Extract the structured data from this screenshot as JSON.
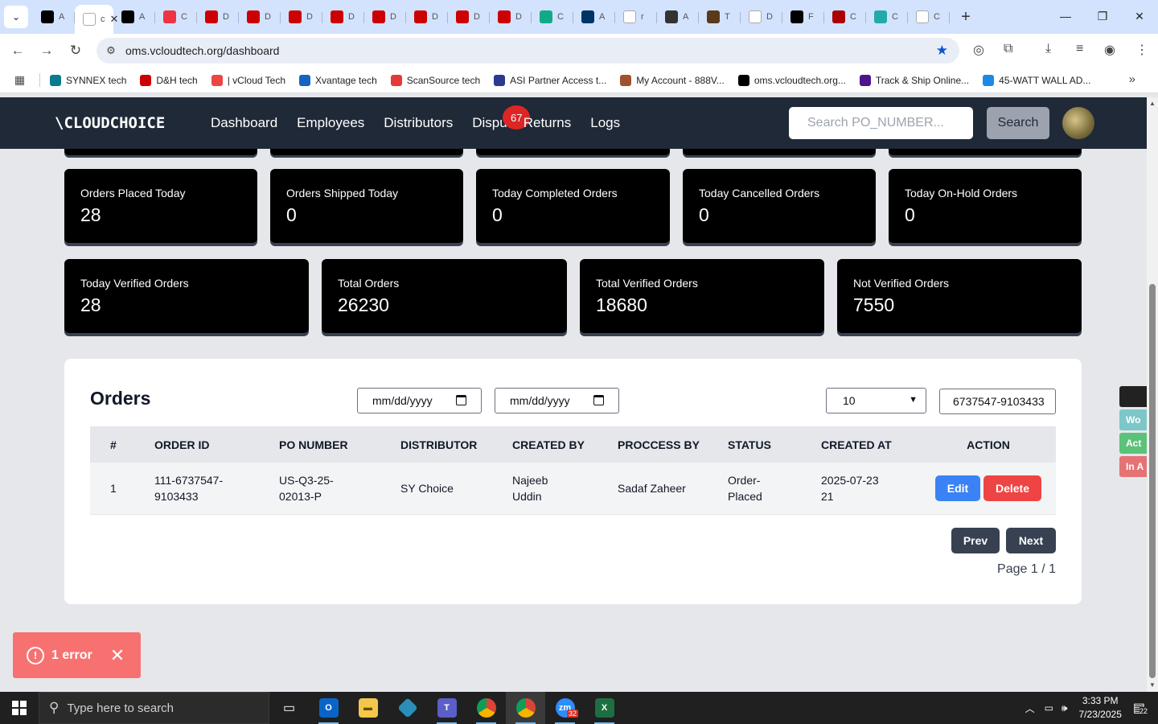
{
  "browser": {
    "tab_chars": [
      "A",
      "c",
      "A",
      "C",
      "D",
      "D",
      "D",
      "D",
      "D",
      "D",
      "D",
      "D",
      "C",
      "A",
      "r",
      "A",
      "T",
      "D",
      "F",
      "C",
      "C",
      "C"
    ],
    "url": "oms.vcloudtech.org/dashboard",
    "bookmarks": [
      {
        "label": "SYNNEX tech",
        "icon": "synnex-icon"
      },
      {
        "label": "D&H tech",
        "icon": "dh-icon"
      },
      {
        "label": "| vCloud Tech",
        "icon": "vcloud-icon"
      },
      {
        "label": "Xvantage tech",
        "icon": "xvantage-icon"
      },
      {
        "label": "ScanSource tech",
        "icon": "scansource-icon"
      },
      {
        "label": "ASI Partner Access t...",
        "icon": "asi-icon"
      },
      {
        "label": "My Account - 888V...",
        "icon": "account-icon"
      },
      {
        "label": "oms.vcloudtech.org...",
        "icon": "oms-icon"
      },
      {
        "label": "Track & Ship Online...",
        "icon": "fedex-icon"
      },
      {
        "label": "45-WATT WALL AD...",
        "icon": "adapter-icon"
      }
    ]
  },
  "app": {
    "logo": "\\CLOUDCHOICE",
    "nav": [
      "Dashboard",
      "Employees",
      "Distributors",
      "Dispu",
      "Returns",
      "Logs"
    ],
    "disputes_badge": "67",
    "search_placeholder": "Search PO_NUMBER...",
    "search_button": "Search"
  },
  "stats_row1": [
    {
      "label": "Orders Placed Today",
      "value": "28"
    },
    {
      "label": "Orders Shipped Today",
      "value": "0"
    },
    {
      "label": "Today Completed Orders",
      "value": "0"
    },
    {
      "label": "Today Cancelled Orders",
      "value": "0"
    },
    {
      "label": "Today On-Hold Orders",
      "value": "0"
    }
  ],
  "stats_row2": [
    {
      "label": "Today Verified Orders",
      "value": "28"
    },
    {
      "label": "Total Orders",
      "value": "26230"
    },
    {
      "label": "Total Verified Orders",
      "value": "18680"
    },
    {
      "label": "Not Verified Orders",
      "value": "7550"
    }
  ],
  "orders": {
    "title": "Orders",
    "date_from_placeholder": "mm/dd/yyyy",
    "date_to_placeholder": "mm/dd/yyyy",
    "per_page": "10",
    "filter_value": "6737547-9103433",
    "columns": [
      "#",
      "ORDER ID",
      "PO NUMBER",
      "DISTRIBUTOR",
      "CREATED BY",
      "PROCCESS BY",
      "STATUS",
      "CREATED AT",
      "ACTION"
    ],
    "rows": [
      {
        "num": "1",
        "order_id": "111-6737547-9103433",
        "po_number": "US-Q3-25-02013-P",
        "distributor": "SY Choice",
        "created_by": "Najeeb Uddin",
        "process_by": "Sadaf Zaheer",
        "status": "Order-Placed",
        "created_at": "2025-07-23 21"
      }
    ],
    "edit_label": "Edit",
    "delete_label": "Delete",
    "prev_label": "Prev",
    "next_label": "Next",
    "page_info": "Page 1 / 1"
  },
  "toast": {
    "text": "1 error"
  },
  "side_tabs": [
    {
      "label": "Wo",
      "color": "#7cc7c8"
    },
    {
      "label": "Act",
      "color": "#5cc27a"
    },
    {
      "label": "In A",
      "color": "#e57373"
    }
  ],
  "taskbar": {
    "search_placeholder": "Type here to search",
    "zoom_badge": "32",
    "time": "3:33 PM",
    "date": "7/23/2025",
    "notifications": "22"
  }
}
